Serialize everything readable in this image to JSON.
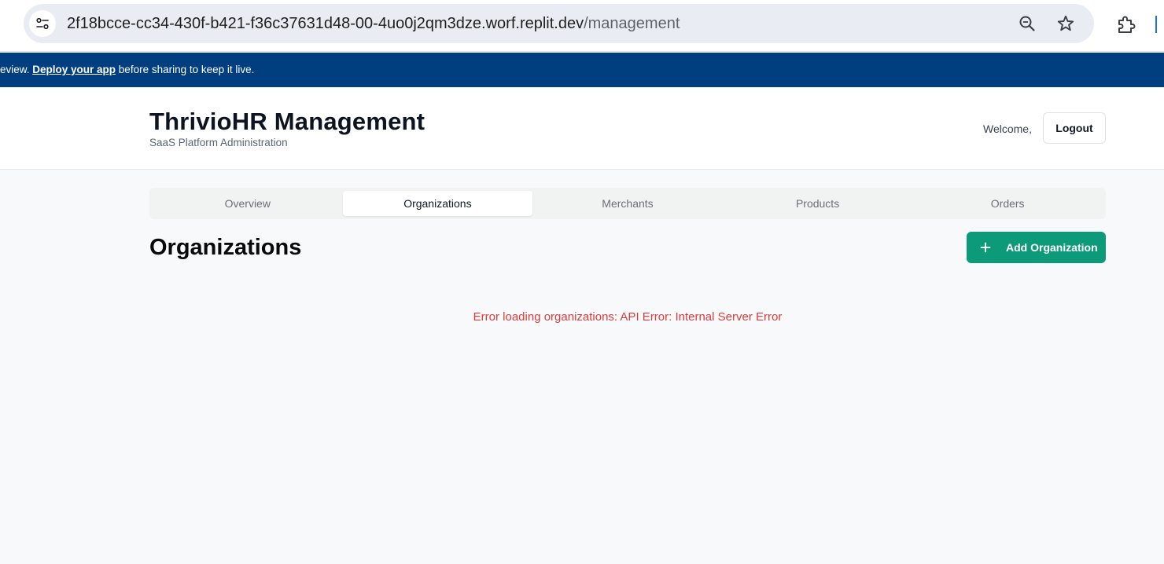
{
  "browser": {
    "url_host": "2f18bcce-cc34-430f-b421-f36c37631d48-00-4uo0j2qm3dze.worf.replit.dev",
    "url_path": "/management"
  },
  "banner": {
    "prefix": "eview. ",
    "link": "Deploy your app",
    "suffix": " before sharing to keep it live."
  },
  "header": {
    "title": "ThrivioHR Management",
    "subtitle": "SaaS Platform Administration",
    "welcome": "Welcome,",
    "logout_label": "Logout"
  },
  "tabs": [
    {
      "label": "Overview",
      "active": false
    },
    {
      "label": "Organizations",
      "active": true
    },
    {
      "label": "Merchants",
      "active": false
    },
    {
      "label": "Products",
      "active": false
    },
    {
      "label": "Orders",
      "active": false
    }
  ],
  "main": {
    "title": "Organizations",
    "add_button_label": "Add Organization",
    "error": "Error loading organizations: API Error: Internal Server Error"
  },
  "colors": {
    "banner": "#003f7f",
    "primary_button": "#0c9a78",
    "error_text": "#dc3c3c"
  },
  "icons": {
    "site_info": "tune-icon",
    "zoom": "zoom-icon",
    "bookmark": "star-icon",
    "extensions": "puzzle-icon",
    "add": "plus-icon"
  }
}
